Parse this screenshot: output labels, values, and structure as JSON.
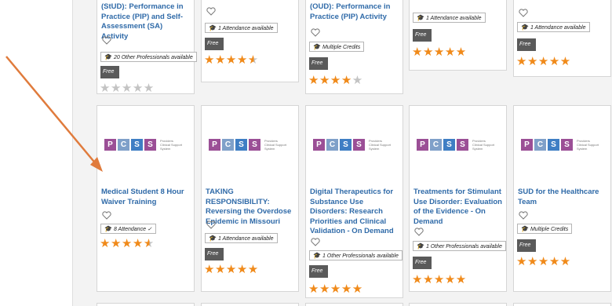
{
  "colors": {
    "accent_title": "#2f6aa8",
    "star": "#f08a1a",
    "star_empty": "#c3c3c3",
    "free_bg": "#5a5a5a",
    "annotation_arrow": "#e07b3c"
  },
  "logo": {
    "letters": [
      "P",
      "C",
      "S",
      "S"
    ],
    "tagline": "Providers Clinical Support System"
  },
  "row1": [
    {
      "title": "(StUD): Performance in Practice (PIP) and Self-Assessment (SA) Activity",
      "tag": "20 Other Professionals available",
      "free": "Free",
      "rating": 0
    },
    {
      "title": "",
      "tag": "1 Attendance available",
      "free": "Free",
      "rating": 4.5
    },
    {
      "title": "(OUD): Performance in Practice (PIP) Activity",
      "tag": "Multiple Credits",
      "free": "Free",
      "rating": 4
    },
    {
      "title": "",
      "tag": "1 Attendance available",
      "free": "Free",
      "rating": 5
    },
    {
      "title": "",
      "tag": "1 Attendance available",
      "free": "Free",
      "rating": 5
    }
  ],
  "row2": [
    {
      "title": "Medical Student 8 Hour Waiver Training",
      "tag": "8 Attendance ✓",
      "free": "",
      "rating": 4.5
    },
    {
      "title": "TAKING RESPONSIBILITY: Reversing the Overdose Epidemic in Missouri",
      "tag": "1 Attendance available",
      "free": "Free",
      "rating": 5
    },
    {
      "title": "Digital Therapeutics for Substance Use Disorders: Research Priorities and Clinical Validation - On Demand",
      "tag": "1 Other Professionals available",
      "free": "Free",
      "rating": 5
    },
    {
      "title": "Treatments for Stimulant Use Disorder: Evaluation of the Evidence - On Demand",
      "tag": "1 Other Professionals available",
      "free": "Free",
      "rating": 5
    },
    {
      "title": "SUD for the Healthcare Team",
      "tag": "Multiple Credits",
      "free": "Free",
      "rating": 5
    }
  ]
}
